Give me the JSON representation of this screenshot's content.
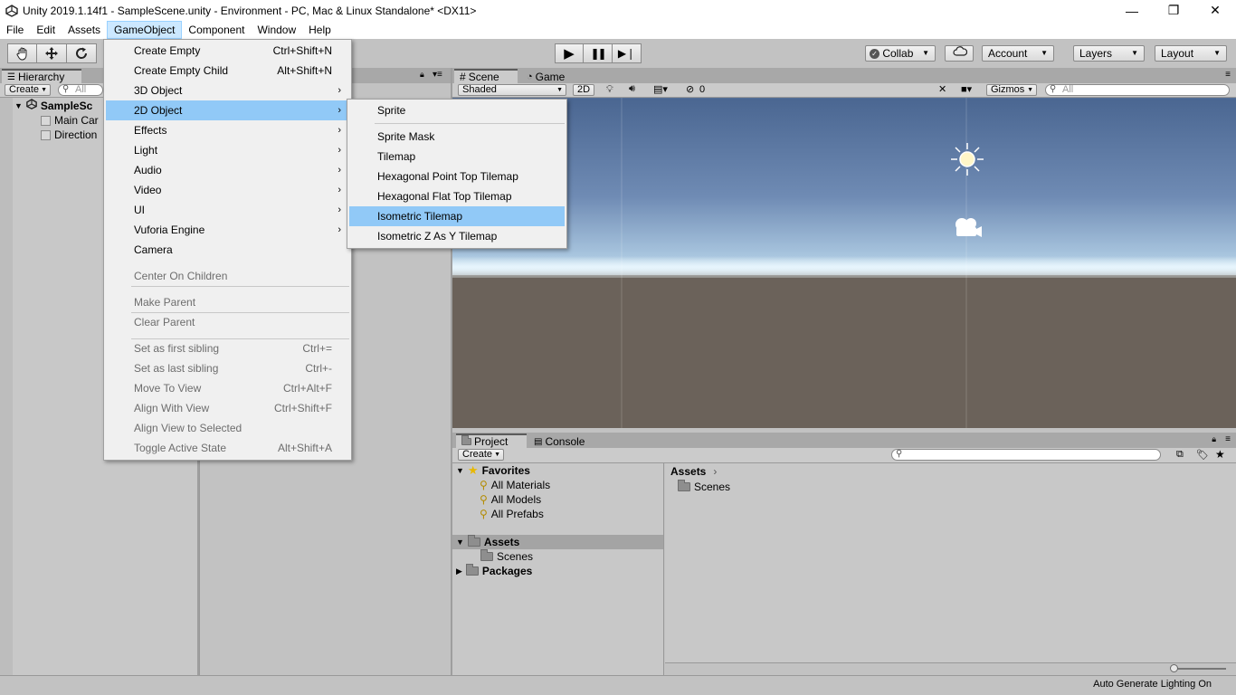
{
  "window": {
    "title": "Unity 2019.1.14f1 - SampleScene.unity - Environment - PC, Mac & Linux Standalone* <DX11>",
    "minimize": "—",
    "restore": "❐",
    "close": "✕"
  },
  "menubar": [
    "File",
    "Edit",
    "Assets",
    "GameObject",
    "Component",
    "Window",
    "Help"
  ],
  "toolbar": {
    "play": "▶",
    "pause": "❚❚",
    "step": "▶❘",
    "collab": "Collab",
    "account": "Account",
    "layers": "Layers",
    "layout": "Layout"
  },
  "hierarchy": {
    "tab": "Hierarchy",
    "create": "Create",
    "search_placeholder": "All",
    "scene": "SampleSc",
    "items": [
      "Main Car",
      "Direction"
    ]
  },
  "scene": {
    "tab_scene": "Scene",
    "tab_game": "Game",
    "shading": "Shaded",
    "mode_2d": "2D",
    "hidden_count": "0",
    "gizmos": "Gizmos",
    "search_placeholder": "All"
  },
  "gameobject_menu": [
    {
      "label": "Create Empty",
      "shortcut": "Ctrl+Shift+N"
    },
    {
      "label": "Create Empty Child",
      "shortcut": "Alt+Shift+N"
    },
    {
      "label": "3D Object",
      "submenu": true
    },
    {
      "label": "2D Object",
      "submenu": true,
      "highlight": true
    },
    {
      "label": "Effects",
      "submenu": true
    },
    {
      "label": "Light",
      "submenu": true
    },
    {
      "label": "Audio",
      "submenu": true
    },
    {
      "label": "Video",
      "submenu": true
    },
    {
      "label": "UI",
      "submenu": true
    },
    {
      "label": "Vuforia Engine",
      "submenu": true
    },
    {
      "label": "Camera"
    },
    {
      "label": "Center On Children",
      "disabled": true
    },
    {
      "label": "Make Parent",
      "disabled": true
    },
    {
      "label": "Clear Parent",
      "disabled": true
    },
    {
      "label": "Set as first sibling",
      "shortcut": "Ctrl+=",
      "disabled": true
    },
    {
      "label": "Set as last sibling",
      "shortcut": "Ctrl+-",
      "disabled": true
    },
    {
      "label": "Move To View",
      "shortcut": "Ctrl+Alt+F",
      "disabled": true
    },
    {
      "label": "Align With View",
      "shortcut": "Ctrl+Shift+F",
      "disabled": true
    },
    {
      "label": "Align View to Selected",
      "disabled": true
    },
    {
      "label": "Toggle Active State",
      "shortcut": "Alt+Shift+A",
      "disabled": true
    }
  ],
  "submenu_2d": [
    {
      "label": "Sprite"
    },
    {
      "label": "Sprite Mask"
    },
    {
      "label": "Tilemap"
    },
    {
      "label": "Hexagonal Point Top Tilemap"
    },
    {
      "label": "Hexagonal Flat Top Tilemap"
    },
    {
      "label": "Isometric Tilemap",
      "highlight": true
    },
    {
      "label": "Isometric Z As Y Tilemap"
    }
  ],
  "submenu_arrow": "›",
  "project": {
    "tab_project": "Project",
    "tab_console": "Console",
    "create": "Create",
    "favorites": "Favorites",
    "fav_items": [
      "All Materials",
      "All Models",
      "All Prefabs"
    ],
    "assets": "Assets",
    "scenes": "Scenes",
    "packages": "Packages",
    "breadcrumb": "Assets",
    "folder_item": "Scenes"
  },
  "status": {
    "text": "Auto Generate Lighting On"
  },
  "colors": {
    "menu_highlight": "#91c9f7",
    "menubar_active": "#cce8ff"
  }
}
